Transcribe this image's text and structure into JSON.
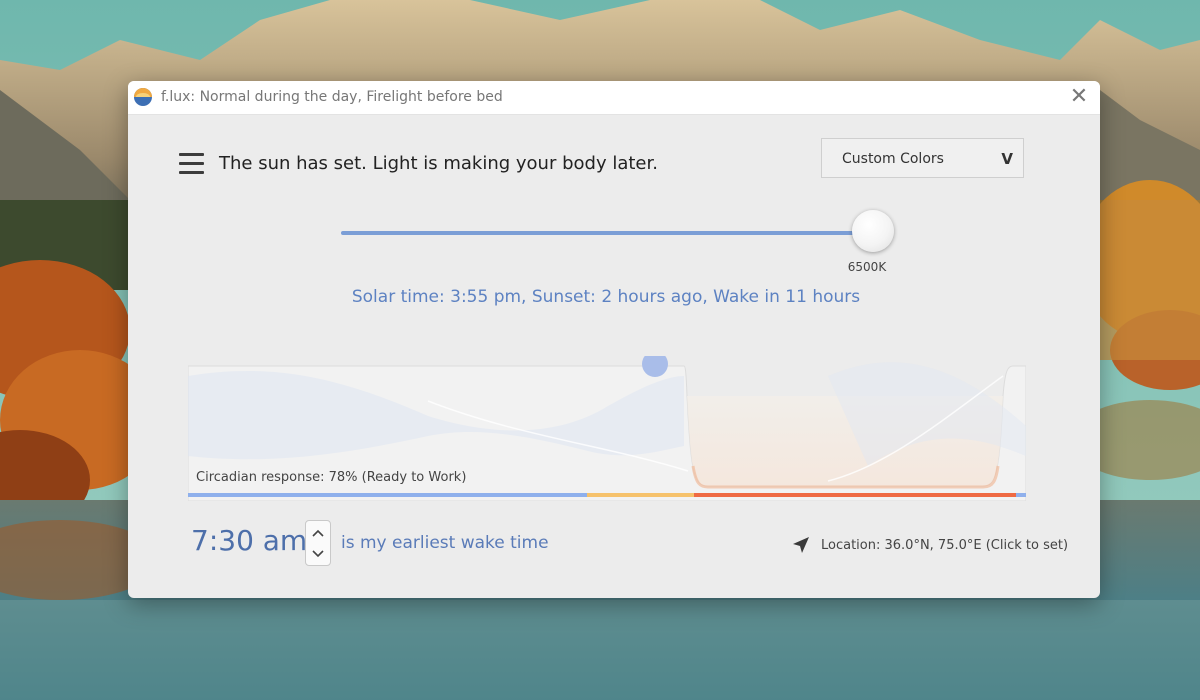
{
  "window": {
    "title": "f.lux: Normal during the day, Firelight before bed",
    "close_glyph": "✕"
  },
  "header": {
    "menu_icon": "hamburger-menu-icon",
    "status_text": "The sun has set. Light is making your body later."
  },
  "color_select": {
    "selected": "Custom Colors",
    "chevron": "V"
  },
  "color_temperature": {
    "value_label": "6500K",
    "slider_level": 1.0
  },
  "solar_info": "Solar time: 3:55 pm, Sunset: 2 hours ago, Wake in 11 hours",
  "timeline": {
    "circadian_response": "Circadian response: 78% (Ready to Work)",
    "colors": {
      "day": "#8fb0ec",
      "sunset": "#f6c26c",
      "bedtime": "#ef6a43",
      "marker": "#a9bde9"
    }
  },
  "wake": {
    "time": "7:30 am",
    "caption": "is my earliest wake time"
  },
  "location": {
    "icon": "navigation-arrow-icon",
    "text": "Location: 36.0°N, 75.0°E (Click to set)"
  },
  "colors": {
    "accent_blue": "#5d82c2",
    "slider_track": "#7b9ed6",
    "window_bg": "#ececec"
  }
}
